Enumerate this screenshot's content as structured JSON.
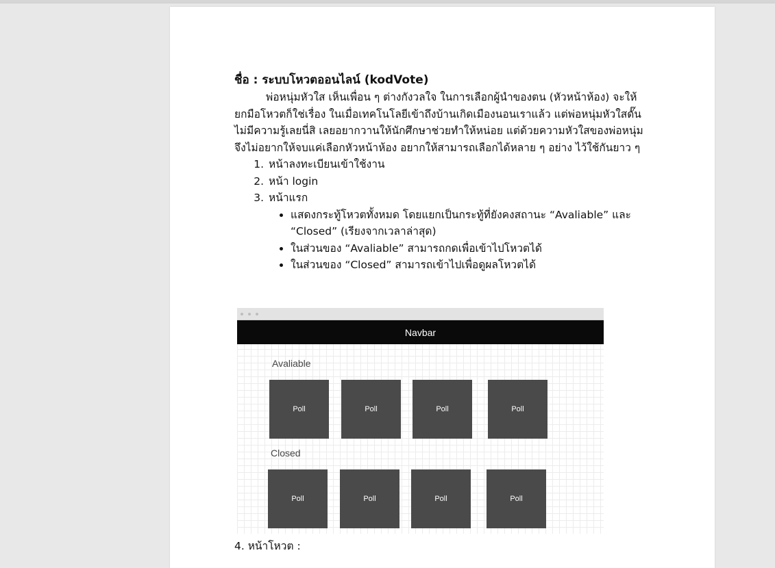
{
  "document": {
    "title": "ชื่อ : ระบบโหวตออนไลน์ (kodVote)",
    "intro": "พ่อหนุ่มหัวใส เห็นเพื่อน ๆ ต่างกังวลใจ ในการเลือกผู้นำของตน (หัวหน้าห้อง) จะให้ยกมือโหวตก็ใช่เรื่อง ในเมื่อเทคโนโลยีเข้าถึงบ้านเกิดเมืองนอนเราแล้ว แต่พ่อหนุ่มหัวใสดั๊นไม่มีความรู้เลยนี่สิ เลยอยากวานให้นักศึกษาช่วยทำให้หน่อย แต่ด้วยความหัวใสของพ่อหนุ่ม จึงไม่อยากให้จบแค่เลือกหัวหน้าห้อง อยากให้สามารถเลือกได้หลาย ๆ อย่าง ไว้ใช้กันยาว ๆ",
    "items": [
      "หน้าลงทะเบียนเข้าใช้งาน",
      "หน้า login",
      "หน้าแรก"
    ],
    "sub_items": [
      "แสดงกระทู้โหวตทั้งหมด โดยแยกเป็นกระทู้ที่ยังคงสถานะ “Avaliable” และ “Closed” (เรียงจากเวลาล่าสุด)",
      "ในส่วนของ “Avaliable” สามารถกดเพื่อเข้าไปโหวตได้",
      "ในส่วนของ “Closed” สามารถเข้าไปเพื่อดูผลโหวตได้"
    ],
    "next_item": "4.  หน้าโหวต :"
  },
  "mockup": {
    "navbar": "Navbar",
    "available_label": "Avaliable",
    "closed_label": "Closed",
    "available_polls": [
      "Poll",
      "Poll",
      "Poll",
      "Poll"
    ],
    "closed_polls": [
      "Poll",
      "Poll",
      "Poll",
      "Poll"
    ]
  }
}
